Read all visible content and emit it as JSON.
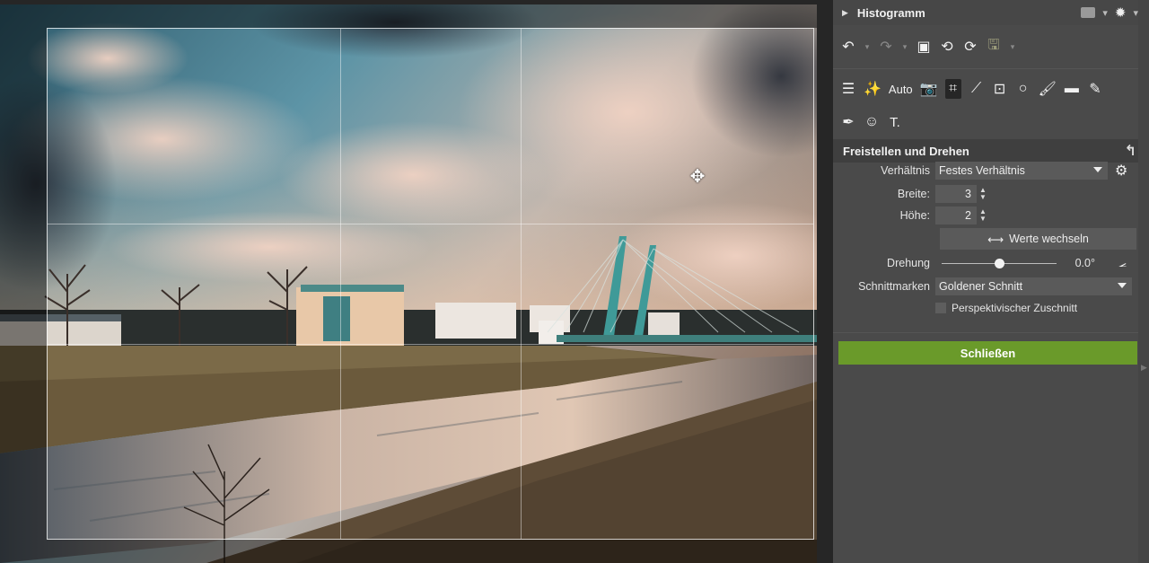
{
  "histogram": {
    "title": "Histogramm"
  },
  "toolbar_row1": {
    "undo_icon": "undo-icon",
    "redo_icon": "redo-icon",
    "image_icon": "image-icon",
    "rotate_left_icon": "rotate-left-icon",
    "rotate_right_icon": "rotate-right-icon",
    "save_icon": "save-icon"
  },
  "toolbar_row2": {
    "auto_label": "Auto"
  },
  "crop_panel": {
    "title": "Freistellen und Drehen",
    "ratio_label": "Verhältnis",
    "ratio_value": "Festes Verhältnis",
    "width_label": "Breite:",
    "width_value": "3",
    "height_label": "Höhe:",
    "height_value": "2",
    "swap_label": "Werte wechseln",
    "rotation_label": "Drehung",
    "rotation_value": "0.0°",
    "rotation_fraction": 0.5,
    "guides_label": "Schnittmarken",
    "guides_value": "Goldener Schnitt",
    "perspective_label": "Perspektivischer Zuschnitt",
    "perspective_checked": false
  },
  "close_label": "Schließen",
  "colors": {
    "panel_bg": "#4a4a4a",
    "accent_green": "#6a9a2a",
    "field_bg": "#5a5a5a"
  }
}
